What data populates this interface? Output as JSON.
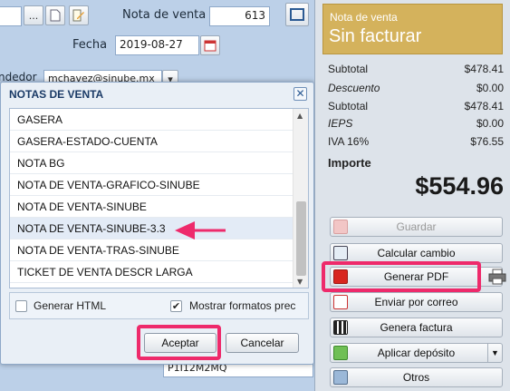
{
  "form": {
    "nota_label": "Nota de venta",
    "nota_value": "613",
    "fecha_label": "Fecha",
    "fecha_value": "2019-08-27",
    "vendedor_label": "ndedor",
    "vendedor_value": "mchavez@sinube.mx",
    "bottom_field_value": "P1I12M2MQ",
    "ellipsis_label": "..."
  },
  "dialog": {
    "title": "NOTAS DE VENTA",
    "close_label": "✕",
    "items": [
      "GASERA",
      "GASERA-ESTADO-CUENTA",
      "NOTA BG",
      "NOTA DE VENTA-GRAFICO-SINUBE",
      "NOTA DE VENTA-SINUBE",
      "NOTA DE VENTA-SINUBE-3.3",
      "NOTA DE VENTA-TRAS-SINUBE",
      "TICKET DE VENTA DESCR LARGA"
    ],
    "selected_index": 5,
    "generar_html_label": "Generar HTML",
    "generar_html_checked": false,
    "mostrar_formatos_label": "Mostrar formatos prec",
    "mostrar_formatos_checked": true,
    "accept_label": "Aceptar",
    "cancel_label": "Cancelar"
  },
  "status": {
    "small": "Nota de venta",
    "big": "Sin facturar",
    "color": "#d4b25c"
  },
  "totals": [
    {
      "label": "Subtotal",
      "value": "$478.41",
      "italic": false
    },
    {
      "label": "Descuento",
      "value": "$0.00",
      "italic": true
    },
    {
      "label": "Subtotal",
      "value": "$478.41",
      "italic": false
    },
    {
      "label": "IEPS",
      "value": "$0.00",
      "italic": true
    },
    {
      "label": "IVA 16%",
      "value": "$76.55",
      "italic": false
    }
  ],
  "importe": {
    "label": "Importe",
    "value": "$554.96"
  },
  "actions": [
    {
      "label": "Guardar",
      "icon": "save-icon",
      "disabled": true
    },
    {
      "label": "Calcular cambio",
      "icon": "calculator-icon",
      "disabled": false
    },
    {
      "label": "Generar PDF",
      "icon": "pdf-icon",
      "disabled": false
    },
    {
      "label": "Enviar por correo",
      "icon": "mail-icon",
      "disabled": false
    },
    {
      "label": "Genera factura",
      "icon": "qr-icon",
      "disabled": false
    },
    {
      "label": "Aplicar depósito",
      "icon": "deposit-icon",
      "disabled": false
    },
    {
      "label": "Otros",
      "icon": "more-icon",
      "disabled": false
    }
  ],
  "colors": {
    "highlight": "#ee2a6b",
    "accent": "#d4b25c",
    "dialog_title": "#1a3a66"
  }
}
